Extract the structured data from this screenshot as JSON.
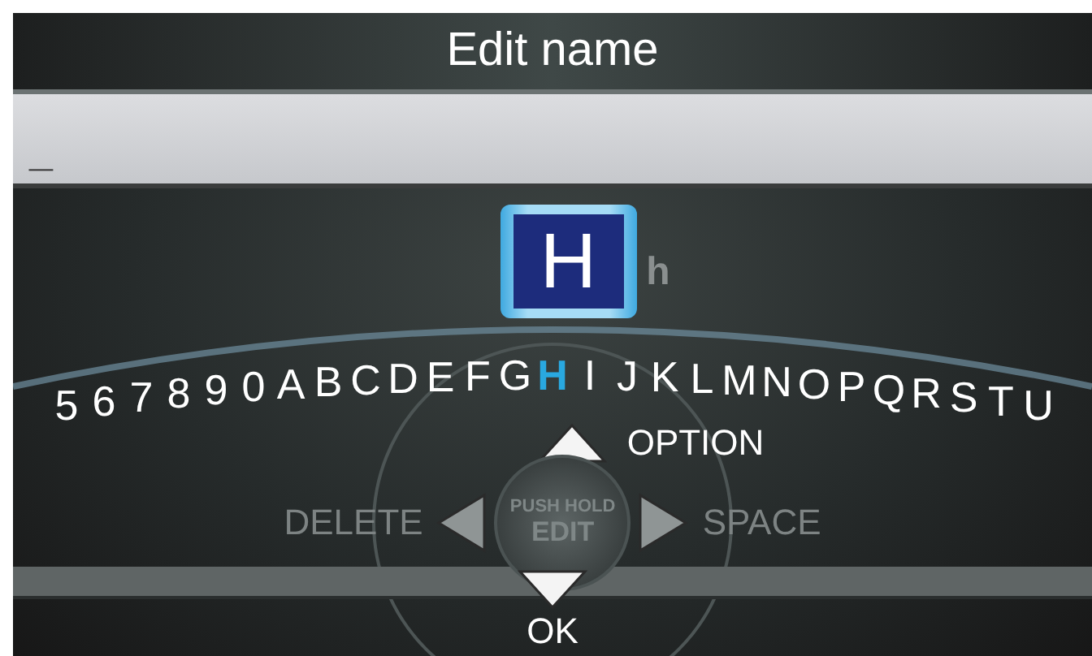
{
  "window": {
    "title": "Edit name"
  },
  "name_field": {
    "value": "_"
  },
  "preview": {
    "upper": "H",
    "lower": "h"
  },
  "characters": [
    {
      "char": "5",
      "selected": false
    },
    {
      "char": "6",
      "selected": false
    },
    {
      "char": "7",
      "selected": false
    },
    {
      "char": "8",
      "selected": false
    },
    {
      "char": "9",
      "selected": false
    },
    {
      "char": "0",
      "selected": false
    },
    {
      "char": "A",
      "selected": false
    },
    {
      "char": "B",
      "selected": false
    },
    {
      "char": "C",
      "selected": false
    },
    {
      "char": "D",
      "selected": false
    },
    {
      "char": "E",
      "selected": false
    },
    {
      "char": "F",
      "selected": false
    },
    {
      "char": "G",
      "selected": false
    },
    {
      "char": "H",
      "selected": true
    },
    {
      "char": "I",
      "selected": false
    },
    {
      "char": "J",
      "selected": false
    },
    {
      "char": "K",
      "selected": false
    },
    {
      "char": "L",
      "selected": false
    },
    {
      "char": "M",
      "selected": false
    },
    {
      "char": "N",
      "selected": false
    },
    {
      "char": "O",
      "selected": false
    },
    {
      "char": "P",
      "selected": false
    },
    {
      "char": "Q",
      "selected": false
    },
    {
      "char": "R",
      "selected": false
    },
    {
      "char": "S",
      "selected": false
    },
    {
      "char": "T",
      "selected": false
    },
    {
      "char": "U",
      "selected": false
    }
  ],
  "controls": {
    "up": {
      "label": "OPTION",
      "disabled": false
    },
    "left": {
      "label": "DELETE",
      "disabled": true
    },
    "right": {
      "label": "SPACE",
      "disabled": true
    },
    "down": {
      "label": "OK",
      "disabled": false
    },
    "knob": {
      "top": "PUSH HOLD",
      "bottom": "EDIT"
    }
  }
}
